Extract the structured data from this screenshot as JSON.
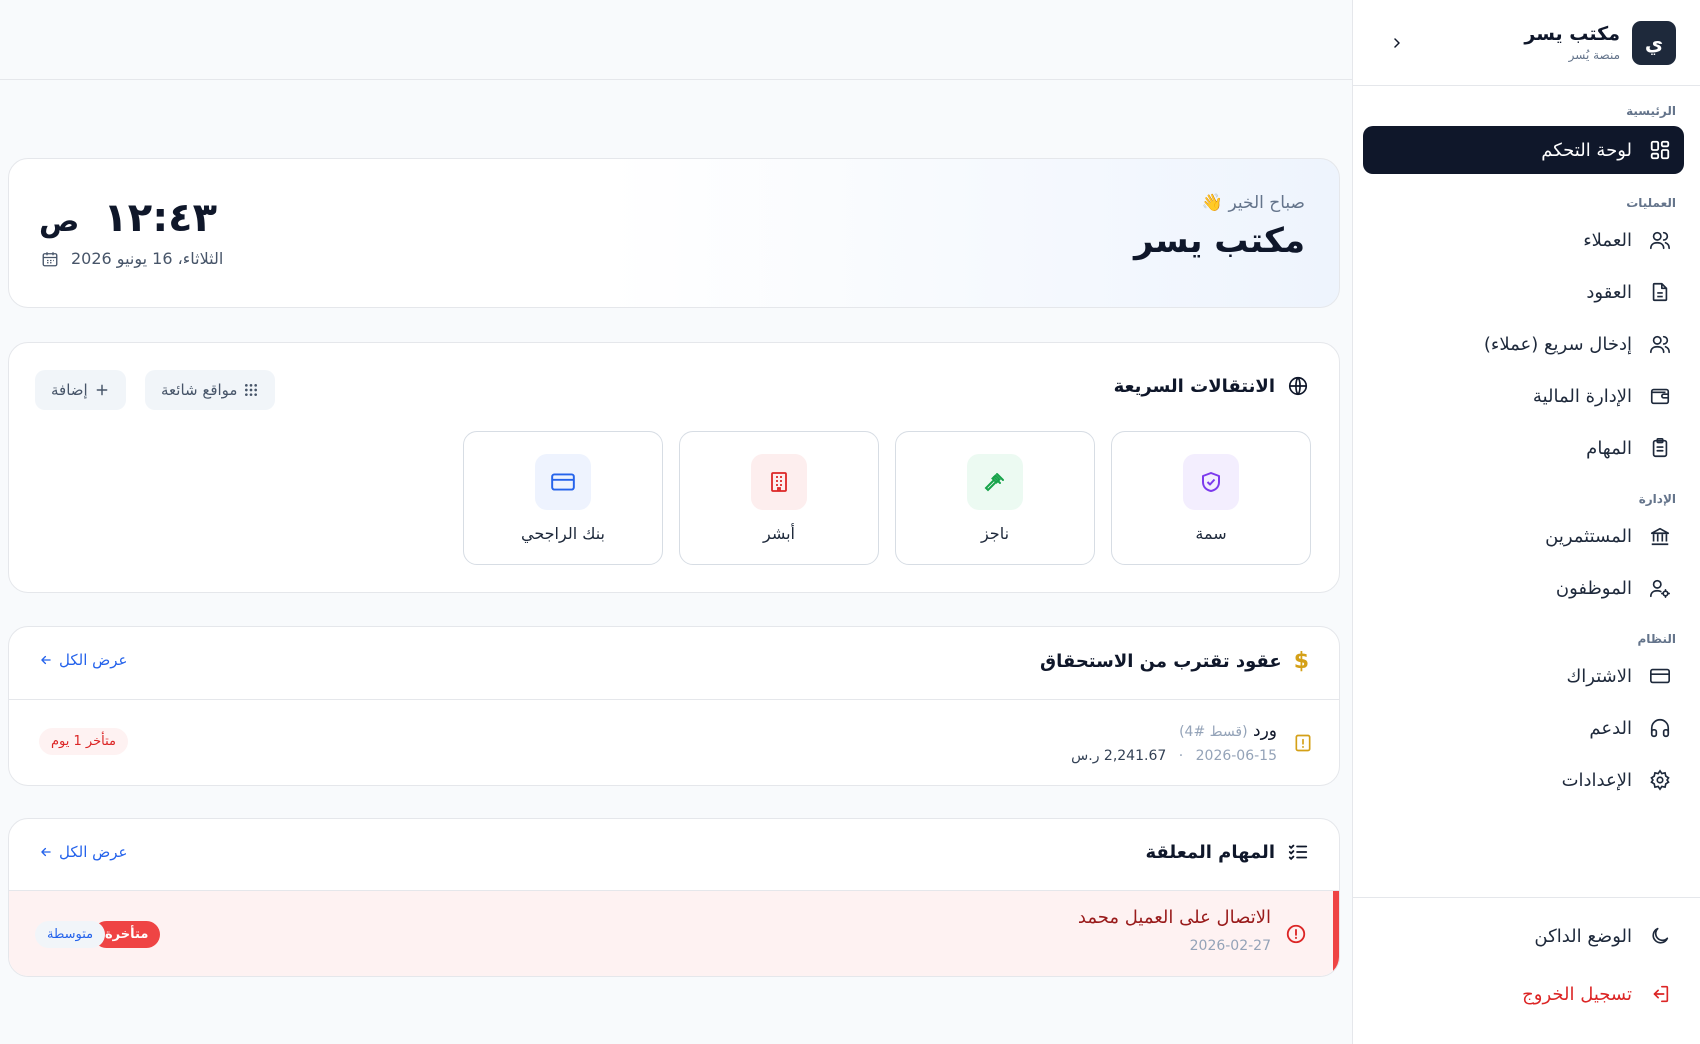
{
  "sidebar": {
    "brand_name": "مكتب يسر",
    "brand_sub": "منصة يُسر",
    "logo_letter": "ي",
    "sections": {
      "main": "الرئيسية",
      "ops": "العمليات",
      "admin": "الإدارة",
      "system": "النظام"
    },
    "items": {
      "dashboard": "لوحة التحكم",
      "clients": "العملاء",
      "contracts": "العقود",
      "quick_entry": "إدخال سريع (عملاء)",
      "finance": "الإدارة المالية",
      "tasks": "المهام",
      "investors": "المستثمرين",
      "employees": "الموظفون",
      "subscription": "الاشتراك",
      "support": "الدعم",
      "settings": "الإعدادات"
    },
    "footer": {
      "dark_mode": "الوضع الداكن",
      "logout": "تسجيل الخروج"
    }
  },
  "welcome": {
    "greeting": "صباح الخير 👋",
    "office_name": "مكتب يسر",
    "time": "١٢:٤٣",
    "ampm": "ص",
    "date": "الثلاثاء، 16 يونيو 2026"
  },
  "quick_links": {
    "title": "الانتقالات السريعة",
    "popular_button": "مواقع شائعة",
    "add_button": "إضافة",
    "tiles": [
      "سمة",
      "ناجز",
      "أبشر",
      "بنك الراجحي"
    ]
  },
  "contracts_due": {
    "title": "عقود تقترب من الاستحقاق",
    "view_all": "عرض الكل",
    "item": {
      "name": "ورد",
      "installment": "(قسط #4)",
      "date": "2026-06-15",
      "separator": "·",
      "amount": "2,241.67 ر.س",
      "status": "متأخر 1 يوم"
    }
  },
  "pending_tasks": {
    "title": "المهام المعلقة",
    "view_all": "عرض الكل",
    "item": {
      "title": "الاتصال على العميل محمد",
      "date": "2026-02-27",
      "status": "متأخرة",
      "priority": "متوسطة"
    }
  },
  "colors": {
    "dark": "#0f172a",
    "danger": "#ef4444",
    "link": "#2563eb",
    "accent_gold": "#d4a017"
  }
}
